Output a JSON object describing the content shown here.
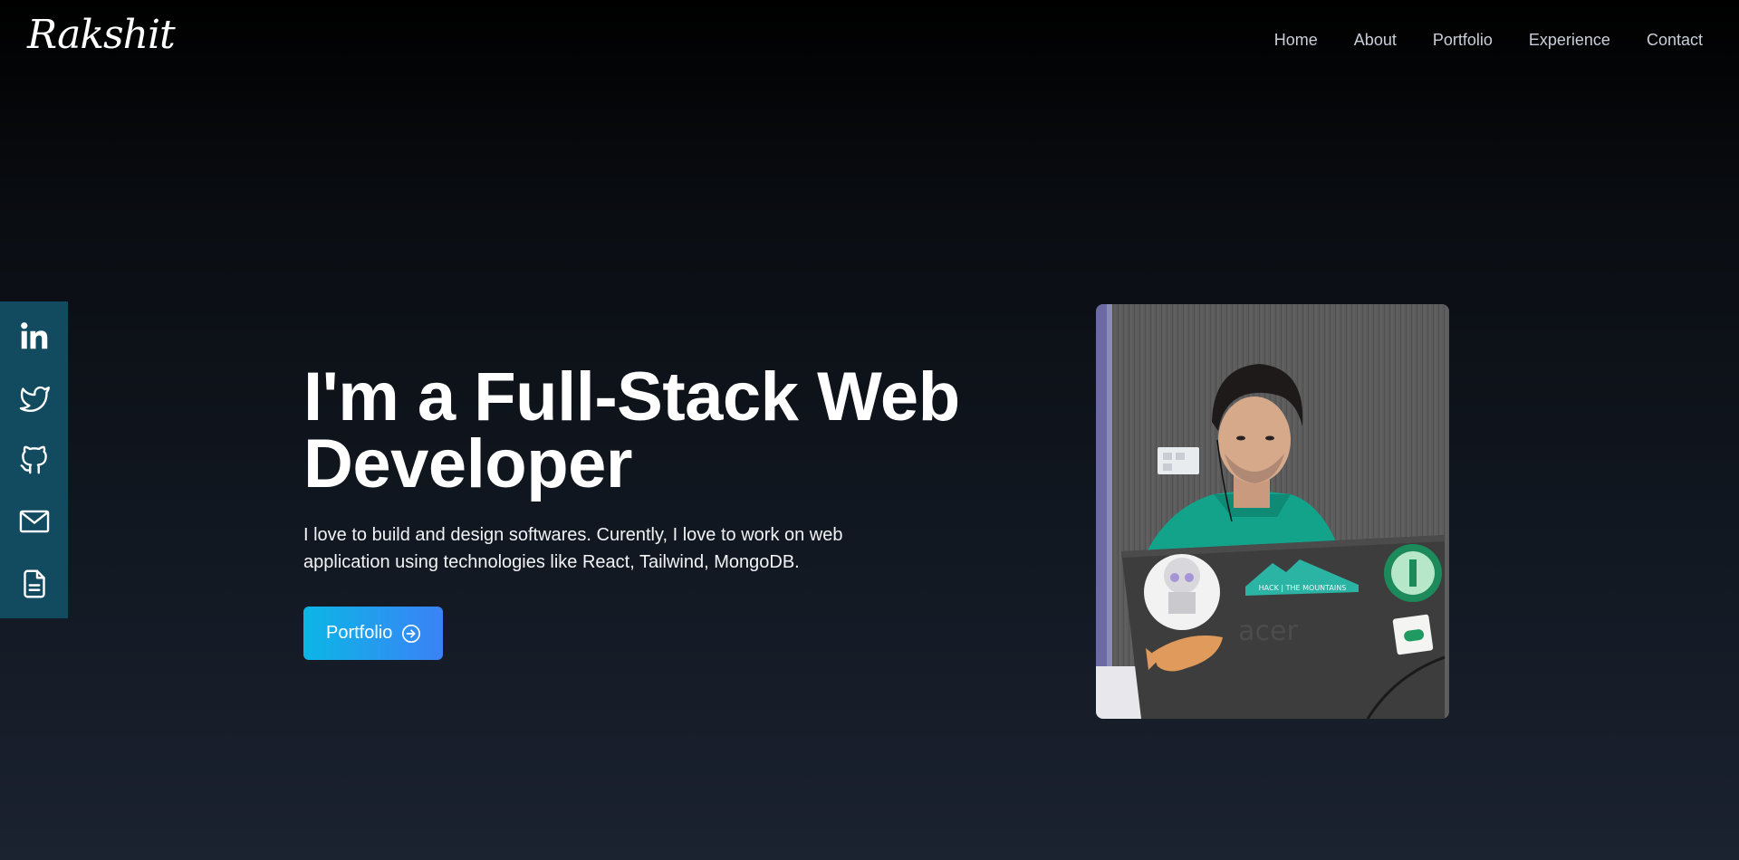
{
  "header": {
    "logo": "Rakshit",
    "nav": [
      {
        "label": "Home"
      },
      {
        "label": "About"
      },
      {
        "label": "Portfolio"
      },
      {
        "label": "Experience"
      },
      {
        "label": "Contact"
      }
    ]
  },
  "social": [
    {
      "icon": "linkedin-icon"
    },
    {
      "icon": "twitter-icon"
    },
    {
      "icon": "github-icon"
    },
    {
      "icon": "mail-icon"
    },
    {
      "icon": "resume-icon"
    }
  ],
  "hero": {
    "title_line1": "I'm a Full-Stack Web",
    "title_line2": "Developer",
    "description": "I love to build and design softwares. Curently, I love to work on web application using technologies like React, Tailwind, MongoDB.",
    "button_label": "Portfolio",
    "button_icon": "arrow-right-circle-icon"
  },
  "photo": {
    "laptop_brand": "acer",
    "sticker_text": "HACK | THE MOUNTAINS"
  },
  "colors": {
    "sidebar": "#124a60",
    "button_start": "#0bb6e6",
    "button_end": "#3b82f6"
  }
}
